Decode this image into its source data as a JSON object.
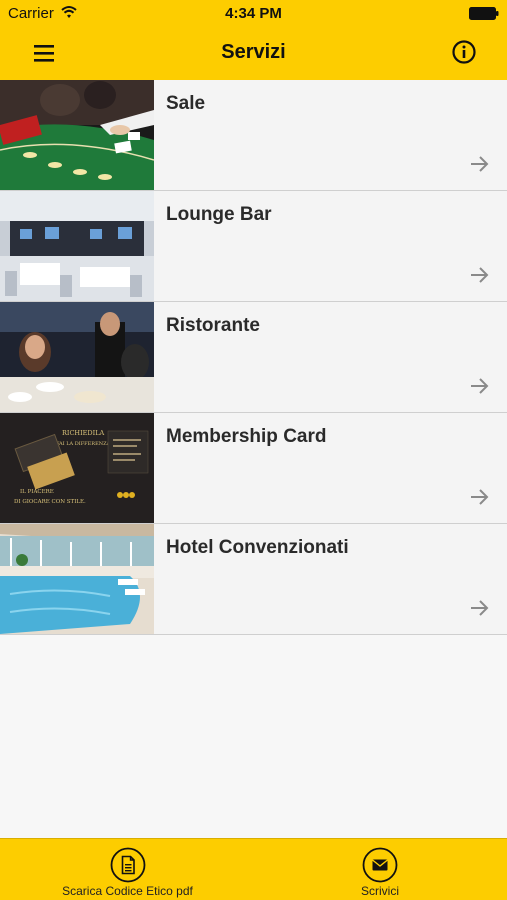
{
  "status": {
    "carrier": "Carrier",
    "time": "4:34 PM"
  },
  "navbar": {
    "title": "Servizi",
    "menu_icon": "hamburger-icon",
    "info_icon": "info-icon"
  },
  "colors": {
    "accent": "#fdcd00",
    "background": "#f4f4f4",
    "divider": "#cfcfcf",
    "arrow": "#8a8a8a"
  },
  "services": [
    {
      "label": "Sale",
      "image": "casino-table-photo"
    },
    {
      "label": "Lounge Bar",
      "image": "lounge-bar-photo"
    },
    {
      "label": "Ristorante",
      "image": "restaurant-photo"
    },
    {
      "label": "Membership Card",
      "image": "membership-card-photo"
    },
    {
      "label": "Hotel Convenzionati",
      "image": "hotel-pool-photo"
    }
  ],
  "membership_image_text": {
    "heading": "RICHIEDILA",
    "line2": "FAI LA DIFFERENZA.",
    "line3": "IL PIACERE",
    "line4": "DI GIOCARE CON STILE."
  },
  "tabbar": {
    "left_label": "Scarica Codice Etico pdf",
    "right_label": "Scrivici"
  }
}
